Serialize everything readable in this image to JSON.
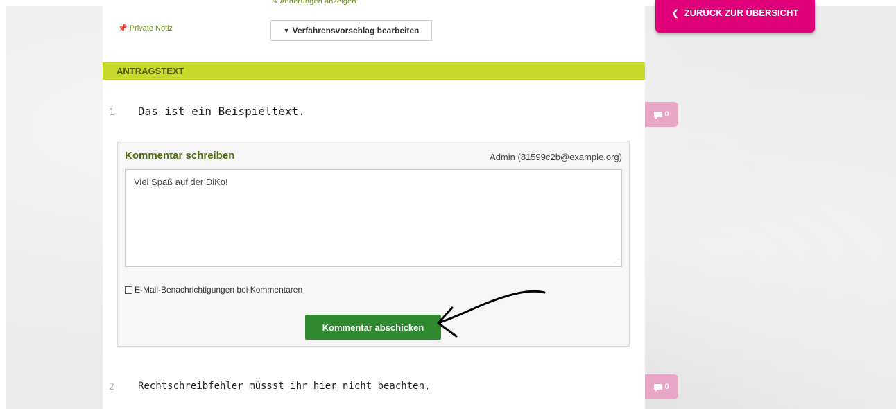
{
  "header": {
    "show_changes_label": "Änderungen anzeigen",
    "private_note_label": "Private Notiz",
    "edit_proposal_label": "Verfahrensvorschlag bearbeiten",
    "back_label": "ZURÜCK ZUR ÜBERSICHT"
  },
  "section": {
    "title": "ANTRAGSTEXT"
  },
  "lines": [
    {
      "number": "1",
      "text": "Das ist ein Beispieltext.",
      "comment_count": "0"
    },
    {
      "number": "2",
      "text": "Rechtschreibfehler müssst ihr hier nicht beachten,",
      "comment_count": "0"
    }
  ],
  "comment_form": {
    "title": "Kommentar schreiben",
    "user": "Admin (81599c2b@example.org)",
    "text_value": "Viel Spaß auf der DiKo!",
    "notify_label": "E-Mail-Benachrichtigungen bei Kommentaren",
    "notify_checked": false,
    "submit_label": "Kommentar abschicken"
  },
  "icons": {
    "pin": "pin-icon",
    "chevron_down": "chevron-down-icon",
    "chevron_left": "chevron-left-icon",
    "comment": "comment-icon"
  },
  "colors": {
    "accent_green": "#c6d92a",
    "magenta": "#e0007a",
    "submit_green": "#2f8a2f",
    "title_green": "#4d6b0e"
  }
}
